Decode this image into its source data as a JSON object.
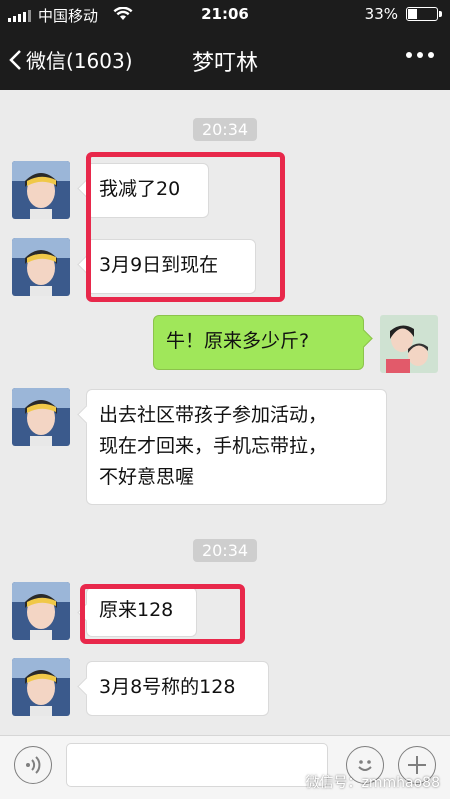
{
  "status_bar": {
    "carrier": "中国移动",
    "time": "21:06",
    "battery_percent_text": "33%",
    "battery_level": 0.33
  },
  "nav": {
    "back_label": "微信(1603)",
    "title": "梦叮林",
    "more_icon": "more-dots-icon"
  },
  "chat": {
    "timestamps": [
      "20:34",
      "20:34"
    ],
    "messages": [
      {
        "from": "other",
        "text": "我减了20",
        "highlighted": true
      },
      {
        "from": "other",
        "text": "3月9日到现在",
        "highlighted": true
      },
      {
        "from": "me",
        "text": "牛！原来多少斤?"
      },
      {
        "from": "other",
        "text": "出去社区带孩子参加活动，\n现在才回来，手机忘带拉，\n不好意思喔"
      },
      {
        "from": "other",
        "text": "原来128",
        "highlighted": true
      },
      {
        "from": "other",
        "text": "3月8号称的128"
      }
    ]
  },
  "input_bar": {
    "voice_icon": "voice-icon",
    "emoji_icon": "emoji-icon",
    "plus_icon": "plus-icon",
    "value": ""
  },
  "watermark": "微信号：zmmhao88",
  "colors": {
    "bar_bg": "#1c1c1c",
    "chat_bg": "#ebebeb",
    "my_bubble": "#a0e75a",
    "highlight": "#e8284b"
  }
}
